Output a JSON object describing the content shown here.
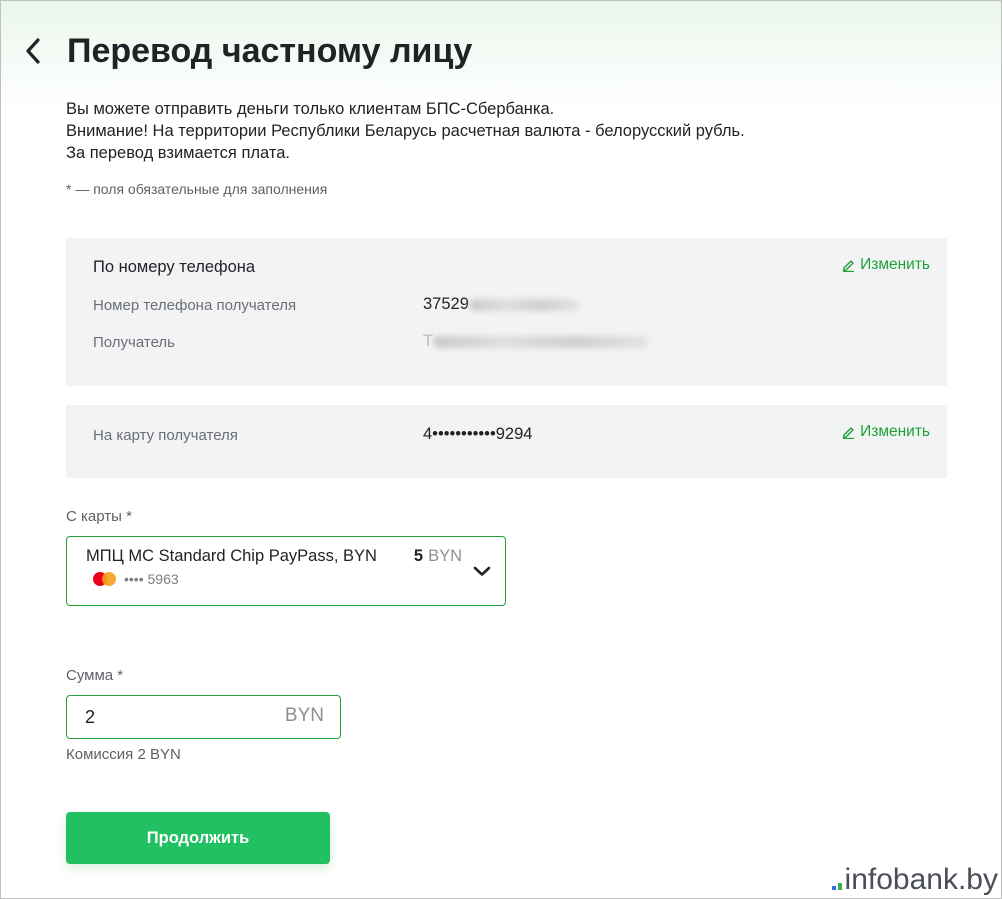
{
  "header": {
    "title": "Перевод частному лицу"
  },
  "info_lines": [
    "Вы можете отправить деньги только клиентам БПС-Сбербанка.",
    "Внимание! На территории Республики Беларусь расчетная валюта - белорусский рубль.",
    "За перевод взимается плата."
  ],
  "required_note": "* — поля обязательные для заполнения",
  "recipient_panel": {
    "title": "По номеру телефона",
    "edit_label": "Изменить",
    "phone_label": "Номер телефона получателя",
    "phone_value": "37529",
    "recipient_label": "Получатель",
    "recipient_value": "Т"
  },
  "card_panel": {
    "label": "На карту получателя",
    "value": "4•••••••••••9294",
    "edit_label": "Изменить"
  },
  "from_card": {
    "label": "С карты *",
    "card_name": "МПЦ MC Standard Chip PayPass, BYN",
    "balance": "5",
    "currency": "BYN",
    "card_number": "•••• 5963"
  },
  "amount": {
    "label": "Сумма *",
    "value": "2",
    "currency": "BYN",
    "commission": "Комиссия 2 BYN"
  },
  "continue_button": "Продолжить",
  "watermark": {
    "name": "infobank",
    "tld": ".by"
  },
  "colors": {
    "accent": "#21a038",
    "button": "#21c062",
    "panel": "#f2f3f4"
  }
}
